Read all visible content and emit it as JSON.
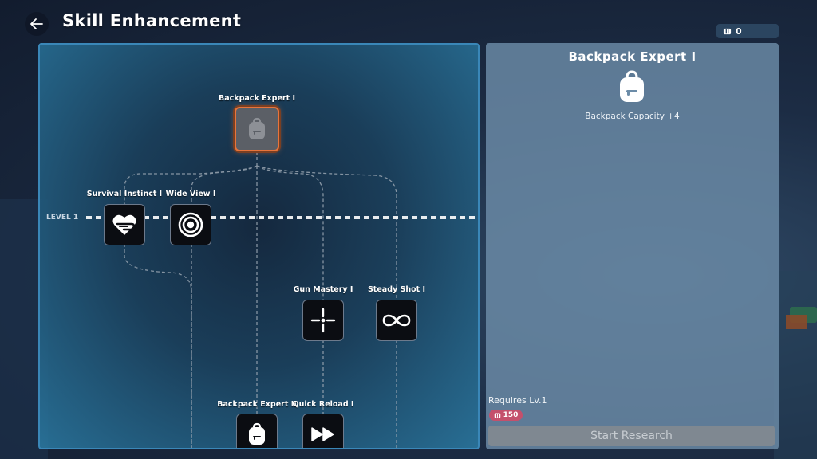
{
  "header": {
    "title": "Skill Enhancement",
    "currency_amount": "0"
  },
  "tree": {
    "level_label": "LEVEL 1",
    "nodes": [
      {
        "id": "backpack-expert-1",
        "label": "Backpack Expert I",
        "icon": "backpack-icon",
        "selected": true
      },
      {
        "id": "survival-instinct-1",
        "label": "Survival Instinct I",
        "icon": "heart-bandage-icon",
        "selected": false
      },
      {
        "id": "wide-view-1",
        "label": "Wide View I",
        "icon": "target-rings-icon",
        "selected": false
      },
      {
        "id": "gun-mastery-1",
        "label": "Gun Mastery I",
        "icon": "crosshair-icon",
        "selected": false
      },
      {
        "id": "steady-shot-1",
        "label": "Steady Shot I",
        "icon": "infinity-icon",
        "selected": false
      },
      {
        "id": "backpack-expert-2",
        "label": "Backpack Expert II",
        "icon": "backpack-icon",
        "selected": false
      },
      {
        "id": "quick-reload-1",
        "label": "Quick Reload I",
        "icon": "fast-forward-icon",
        "selected": false
      }
    ]
  },
  "detail": {
    "title": "Backpack Expert I",
    "icon": "backpack-icon",
    "effect": "Backpack Capacity +4",
    "requires": "Requires Lv.1",
    "cost": "150",
    "action_label": "Start Research"
  },
  "colors": {
    "selected_border": "#e8743b",
    "cost_badge": "#c4506c",
    "panel_border": "#3a87b8"
  }
}
